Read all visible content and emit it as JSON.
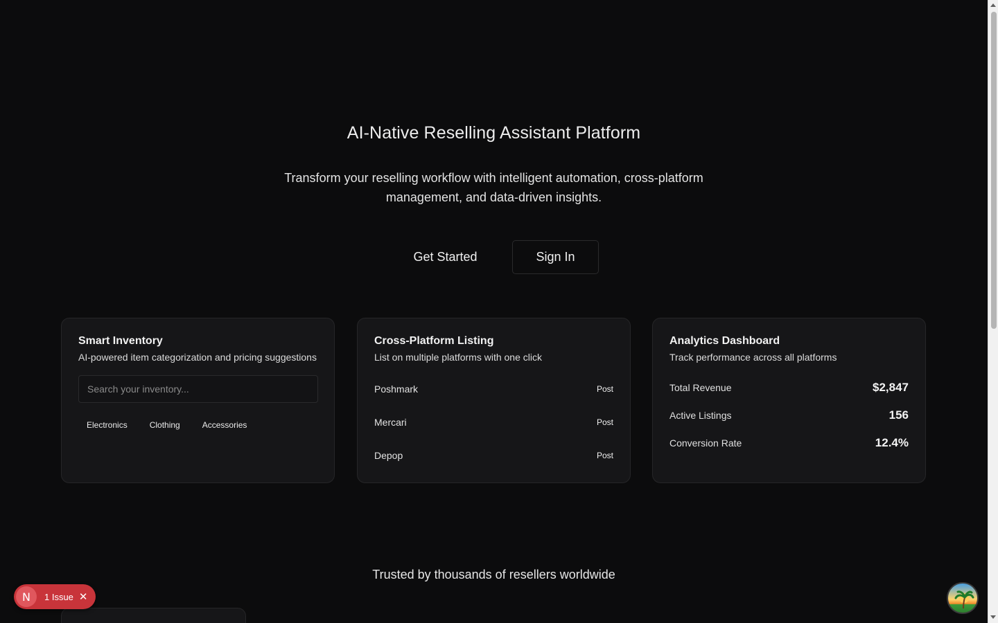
{
  "hero": {
    "title": "AI-Native Reselling Assistant Platform",
    "subtitle": "Transform your reselling workflow with intelligent automation, cross-platform management, and data-driven insights.",
    "get_started_label": "Get Started",
    "sign_in_label": "Sign In"
  },
  "inventory_card": {
    "title": "Smart Inventory",
    "description": "AI-powered item categorization and pricing suggestions",
    "search_placeholder": "Search your inventory...",
    "tags": [
      "Electronics",
      "Clothing",
      "Accessories"
    ]
  },
  "listing_card": {
    "title": "Cross-Platform Listing",
    "description": "List on multiple platforms with one click",
    "platforms": [
      {
        "name": "Poshmark",
        "action": "Post"
      },
      {
        "name": "Mercari",
        "action": "Post"
      },
      {
        "name": "Depop",
        "action": "Post"
      }
    ]
  },
  "analytics_card": {
    "title": "Analytics Dashboard",
    "description": "Track performance across all platforms",
    "stats": [
      {
        "label": "Total Revenue",
        "value": "$2,847"
      },
      {
        "label": "Active Listings",
        "value": "156"
      },
      {
        "label": "Conversion Rate",
        "value": "12.4%"
      }
    ]
  },
  "trusted": {
    "text": "Trusted by thousands of resellers worldwide"
  },
  "dev_overlay": {
    "logo_letter": "N",
    "issue_label": "1 Issue",
    "close_glyph": "✕"
  },
  "icons": {
    "issue_logo": "nextjs-logo-icon",
    "close": "close-icon",
    "avatar": "avatar-island-icon"
  },
  "colors": {
    "background": "#0c0c0d",
    "card": "#161618",
    "issue_pill": "#c8343a"
  }
}
